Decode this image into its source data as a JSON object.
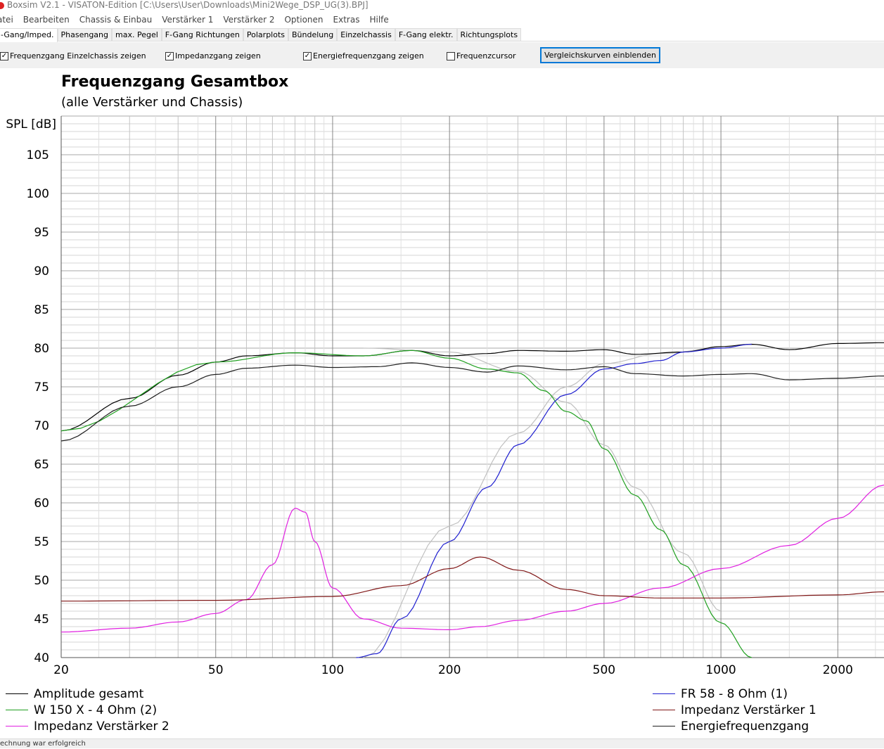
{
  "window": {
    "title": "Boxsim V2.1 - VISATON-Edition [C:\\Users\\User\\Downloads\\Mini2Wege_DSP_UG(3).BPJ]"
  },
  "menu": [
    "atei",
    "Bearbeiten",
    "Chassis & Einbau",
    "Verstärker 1",
    "Verstärker 2",
    "Optionen",
    "Extras",
    "Hilfe"
  ],
  "tabs": [
    "-Gang/Imped.",
    "Phasengang",
    "max. Pegel",
    "F-Gang Richtungen",
    "Polarplots",
    "Bündelung",
    "Einzelchassis",
    "F-Gang elektr.",
    "Richtungsplots"
  ],
  "toolbar": {
    "checkboxes": [
      {
        "label": "Frequenzgang Einzelchassis zeigen",
        "checked": true
      },
      {
        "label": "Impedanzgang zeigen",
        "checked": true
      },
      {
        "label": "Energiefrequenzgang zeigen",
        "checked": true
      },
      {
        "label": "Frequenzcursor",
        "checked": false
      }
    ],
    "button": "Vergleichskurven einblenden"
  },
  "status": "echnung war erfolgreich",
  "chart_data": {
    "type": "line",
    "title": "Frequenzgang Gesamtbox",
    "subtitle": "(alle Verstärker und Chassis)",
    "ylabel": "SPL [dB]",
    "xlabel": "",
    "xscale": "log",
    "xlim": [
      20,
      2630
    ],
    "ylim": [
      40,
      110
    ],
    "xticks": [
      20,
      50,
      100,
      200,
      500,
      1000,
      2000
    ],
    "xtick_labels": [
      "20",
      "50",
      "100",
      "200",
      "500",
      "1000",
      "2000"
    ],
    "yticks": [
      40,
      45,
      50,
      55,
      60,
      65,
      70,
      75,
      80,
      85,
      90,
      95,
      100,
      105
    ],
    "grid": true,
    "series": [
      {
        "name": "Amplitude gesamt",
        "color": "#000000",
        "legend": "left",
        "points": [
          [
            20,
            69.3
          ],
          [
            30,
            73.5
          ],
          [
            40,
            76.5
          ],
          [
            50,
            78.2
          ],
          [
            60,
            79
          ],
          [
            80,
            79.4
          ],
          [
            100,
            79
          ],
          [
            120,
            79
          ],
          [
            160,
            79.7
          ],
          [
            200,
            79
          ],
          [
            250,
            79.3
          ],
          [
            300,
            79.7
          ],
          [
            400,
            79.6
          ],
          [
            500,
            79.8
          ],
          [
            600,
            79.2
          ],
          [
            800,
            79.5
          ],
          [
            1000,
            80.2
          ],
          [
            1200,
            80.5
          ],
          [
            1500,
            79.8
          ],
          [
            2000,
            80.6
          ],
          [
            2630,
            80.7
          ]
        ]
      },
      {
        "name": "W 150 X - 4 Ohm (2)",
        "color": "#20a020",
        "legend": "left",
        "points": [
          [
            20,
            69.3
          ],
          [
            50,
            78.2
          ],
          [
            80,
            79.4
          ],
          [
            120,
            79
          ],
          [
            160,
            79.7
          ],
          [
            200,
            78.7
          ],
          [
            250,
            77.3
          ],
          [
            300,
            76.8
          ],
          [
            350,
            74.5
          ],
          [
            400,
            71.8
          ],
          [
            450,
            70.6
          ],
          [
            500,
            67
          ],
          [
            600,
            61
          ],
          [
            700,
            56.5
          ],
          [
            800,
            52
          ],
          [
            1000,
            44.5
          ],
          [
            1200,
            40
          ]
        ]
      },
      {
        "name": "Impedanz Verstärker 2",
        "color": "#e020e0",
        "legend": "left",
        "points": [
          [
            20,
            43.3
          ],
          [
            30,
            43.8
          ],
          [
            40,
            44.6
          ],
          [
            50,
            45.7
          ],
          [
            60,
            47.5
          ],
          [
            70,
            52
          ],
          [
            80,
            59.3
          ],
          [
            85,
            58.8
          ],
          [
            90,
            55
          ],
          [
            100,
            49
          ],
          [
            120,
            45
          ],
          [
            150,
            43.8
          ],
          [
            200,
            43.6
          ],
          [
            240,
            44
          ],
          [
            300,
            44.8
          ],
          [
            400,
            46
          ],
          [
            500,
            47
          ],
          [
            700,
            49
          ],
          [
            1000,
            51.5
          ],
          [
            1500,
            54.5
          ],
          [
            2000,
            58
          ],
          [
            2630,
            62.3
          ]
        ]
      },
      {
        "name": "FR 58 - 8 Ohm (1)",
        "color": "#2020d0",
        "legend": "right",
        "points": [
          [
            115,
            40
          ],
          [
            130,
            40.5
          ],
          [
            150,
            45
          ],
          [
            200,
            55
          ],
          [
            250,
            62
          ],
          [
            300,
            67.5
          ],
          [
            400,
            74
          ],
          [
            500,
            77.3
          ],
          [
            600,
            78
          ],
          [
            700,
            78.4
          ],
          [
            800,
            79.5
          ],
          [
            1000,
            80
          ],
          [
            1200,
            80.5
          ]
        ]
      },
      {
        "name": "Impedanz Verstärker 1",
        "color": "#801818",
        "legend": "right",
        "points": [
          [
            20,
            47.3
          ],
          [
            50,
            47.4
          ],
          [
            100,
            47.9
          ],
          [
            150,
            49.3
          ],
          [
            200,
            51.5
          ],
          [
            240,
            53
          ],
          [
            300,
            51.3
          ],
          [
            400,
            48.8
          ],
          [
            500,
            48
          ],
          [
            700,
            47.7
          ],
          [
            1000,
            47.7
          ],
          [
            2000,
            48.1
          ],
          [
            2630,
            48.5
          ]
        ]
      },
      {
        "name": "Energiefrequenzgang",
        "color": "#202020",
        "legend": "right",
        "points": [
          [
            20,
            68
          ],
          [
            30,
            72.5
          ],
          [
            40,
            75
          ],
          [
            50,
            76.6
          ],
          [
            60,
            77.4
          ],
          [
            80,
            77.8
          ],
          [
            100,
            77.5
          ],
          [
            130,
            77.6
          ],
          [
            160,
            78.1
          ],
          [
            200,
            77.5
          ],
          [
            250,
            76.9
          ],
          [
            300,
            77.7
          ],
          [
            400,
            77.2
          ],
          [
            500,
            77.6
          ],
          [
            600,
            76.7
          ],
          [
            800,
            76.4
          ],
          [
            1000,
            76.6
          ],
          [
            1200,
            76.7
          ],
          [
            1500,
            75.9
          ],
          [
            2000,
            76.1
          ],
          [
            2630,
            76.4
          ]
        ]
      },
      {
        "name": "",
        "color": "#c0c0c0",
        "legend": "none",
        "points": [
          [
            120,
            40
          ],
          [
            200,
            57
          ],
          [
            300,
            69
          ],
          [
            400,
            75
          ],
          [
            500,
            78
          ],
          [
            700,
            79.3
          ],
          [
            1000,
            80
          ]
        ]
      },
      {
        "name": "",
        "color": "#c0c0c0",
        "legend": "none",
        "points": [
          [
            120,
            80
          ],
          [
            200,
            79.5
          ],
          [
            300,
            77
          ],
          [
            400,
            73
          ],
          [
            500,
            67.5
          ],
          [
            600,
            62
          ],
          [
            800,
            53.5
          ],
          [
            1000,
            46
          ]
        ]
      }
    ]
  }
}
